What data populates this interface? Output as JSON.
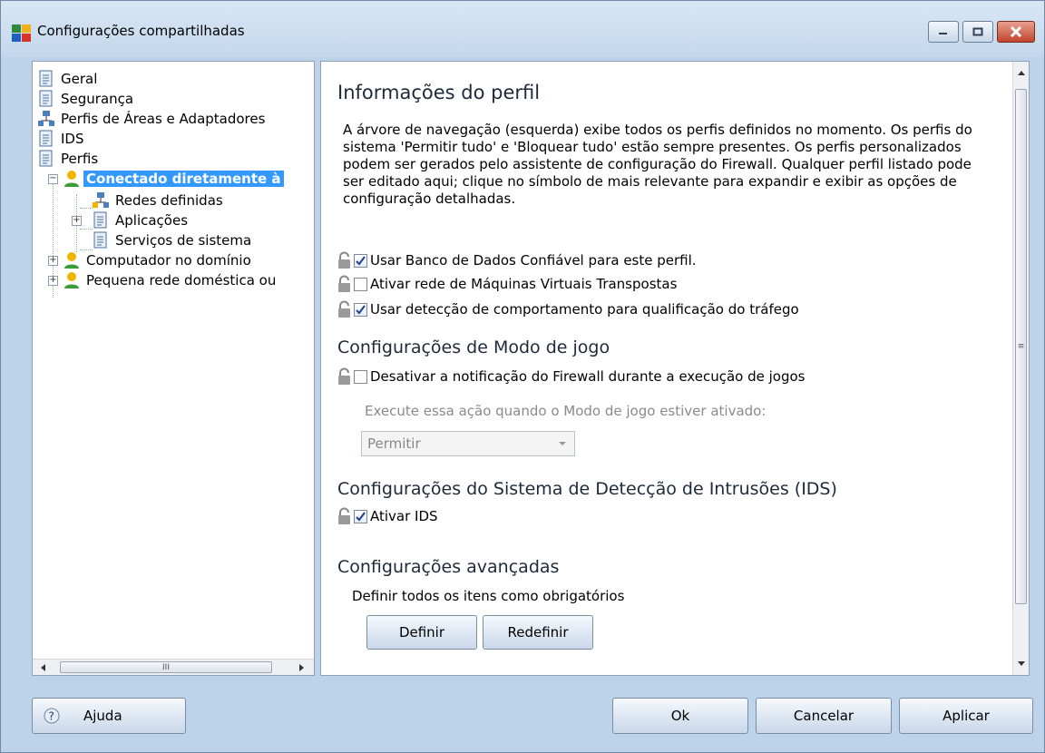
{
  "window": {
    "title": "Configurações compartilhadas",
    "icons": [
      "avg-logo-icon",
      "minimize-icon",
      "maximize-icon",
      "close-icon"
    ]
  },
  "tree": {
    "items": [
      {
        "label": "Geral",
        "icon": "page-icon"
      },
      {
        "label": "Segurança",
        "icon": "page-icon"
      },
      {
        "label": "Perfis de Áreas e Adaptadores",
        "icon": "network-icon"
      },
      {
        "label": "IDS",
        "icon": "page-icon"
      },
      {
        "label": "Perfis",
        "icon": "page-icon"
      },
      {
        "label": "Conectado diretamente à",
        "icon": "user-icon",
        "selected": true
      },
      {
        "label": "Redes definidas",
        "icon": "network-icon"
      },
      {
        "label": "Aplicações",
        "icon": "page-icon"
      },
      {
        "label": "Serviços de sistema",
        "icon": "page-icon"
      },
      {
        "label": "Computador no domínio",
        "icon": "user-icon"
      },
      {
        "label": "Pequena rede doméstica ou",
        "icon": "user-icon"
      }
    ],
    "scroll_glyph": "III"
  },
  "content": {
    "profile_title": "Informações do perfil",
    "description": "A árvore de navegação (esquerda) exibe todos os perfis definidos no momento. Os perfis do sistema 'Permitir tudo' e 'Bloquear tudo' estão sempre presentes. Os perfis personalizados podem ser gerados pelo assistente de configuração do Firewall. Qualquer perfil listado pode ser editado aqui; clique no símbolo de mais relevante para expandir e exibir as opções de configuração detalhadas.",
    "options": [
      {
        "label": "Usar Banco de Dados Confiável para este perfil.",
        "checked": true
      },
      {
        "label": "Ativar rede de Máquinas Virtuais Transpostas",
        "checked": false
      },
      {
        "label": "Usar detecção de comportamento para qualificação do tráfego",
        "checked": true
      }
    ],
    "game_title": "Configurações de Modo de jogo",
    "game_option": {
      "label": "Desativar a notificação do Firewall durante a execução de jogos",
      "checked": false
    },
    "game_action_label": "Execute essa ação quando o Modo de jogo estiver ativado:",
    "game_action_value": "Permitir",
    "ids_title": "Configurações do Sistema de Detecção de Intrusões (IDS)",
    "ids_option": {
      "label": "Ativar IDS",
      "checked": true
    },
    "advanced_title": "Configurações avançadas",
    "advanced_text": "Definir todos os itens como obrigatórios",
    "define_button": "Definir",
    "reset_button": "Redefinir"
  },
  "footer": {
    "help": "Ajuda",
    "ok": "Ok",
    "cancel": "Cancelar",
    "apply": "Aplicar"
  }
}
